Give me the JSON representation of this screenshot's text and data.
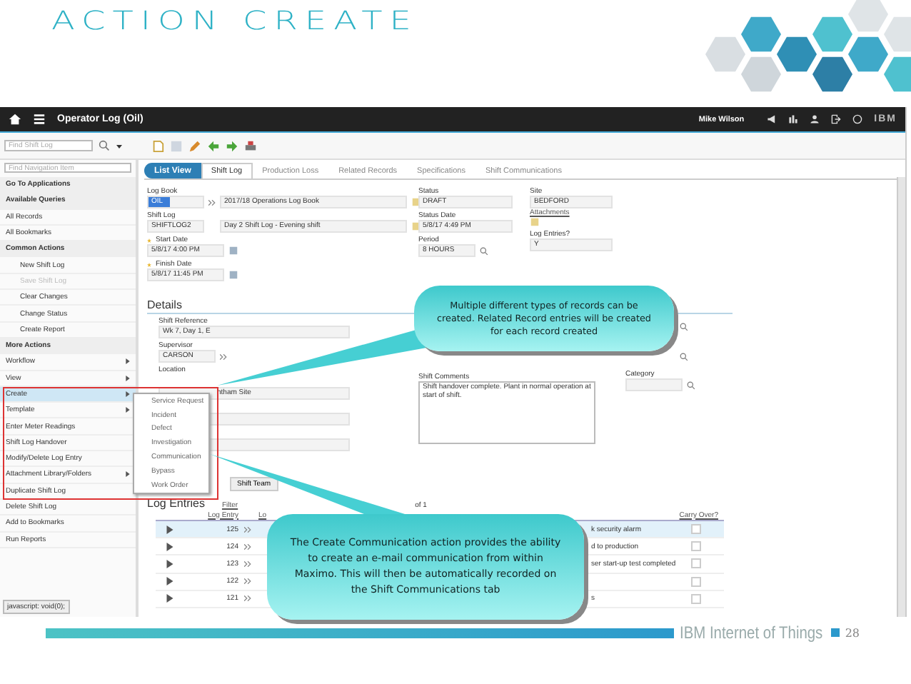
{
  "slide": {
    "title": "ACTION CREATE",
    "footer": "IBM Internet of Things",
    "page": "28"
  },
  "app": {
    "title": "Operator Log (Oil)",
    "user": "Mike Wilson",
    "brand": "IBM",
    "find_placeholder": "Find Shift Log",
    "status_bar": "javascript: void(0);"
  },
  "sidebar": {
    "search_placeholder": "Find Navigation Item",
    "items": [
      {
        "kind": "header",
        "label": "Go To Applications"
      },
      {
        "kind": "header",
        "label": "Available Queries"
      },
      {
        "kind": "link",
        "label": "All Records"
      },
      {
        "kind": "link",
        "label": "All Bookmarks"
      },
      {
        "kind": "header",
        "label": "Common Actions"
      },
      {
        "kind": "action",
        "label": "New Shift Log",
        "disabled": false
      },
      {
        "kind": "action",
        "label": "Save Shift Log",
        "disabled": true
      },
      {
        "kind": "action",
        "label": "Clear Changes",
        "disabled": false
      },
      {
        "kind": "action",
        "label": "Change Status",
        "disabled": false
      },
      {
        "kind": "action",
        "label": "Create Report",
        "disabled": false
      },
      {
        "kind": "header",
        "label": "More Actions"
      },
      {
        "kind": "menu",
        "label": "Workflow",
        "has_submenu": true,
        "selected": false
      },
      {
        "kind": "menu",
        "label": "View",
        "has_submenu": true,
        "selected": false
      },
      {
        "kind": "menu",
        "label": "Create",
        "has_submenu": true,
        "selected": true
      },
      {
        "kind": "menu",
        "label": "Template",
        "has_submenu": true,
        "selected": false
      },
      {
        "kind": "menu",
        "label": "Enter Meter Readings",
        "has_submenu": false,
        "selected": false
      },
      {
        "kind": "menu",
        "label": "Shift Log Handover",
        "has_submenu": false,
        "selected": false
      },
      {
        "kind": "menu",
        "label": "Modify/Delete Log Entry",
        "has_submenu": false,
        "selected": false
      },
      {
        "kind": "menu",
        "label": "Attachment Library/Folders",
        "has_submenu": true,
        "selected": false
      },
      {
        "kind": "menu",
        "label": "Duplicate Shift Log",
        "has_submenu": false,
        "selected": false
      },
      {
        "kind": "menu",
        "label": "Delete Shift Log",
        "has_submenu": false,
        "selected": false
      },
      {
        "kind": "menu",
        "label": "Add to Bookmarks",
        "has_submenu": false,
        "selected": false
      },
      {
        "kind": "menu",
        "label": "Run Reports",
        "has_submenu": false,
        "selected": false
      }
    ]
  },
  "popup_menu": [
    "Service Request",
    "Incident",
    "Defect",
    "Investigation",
    "Communication",
    "Bypass",
    "Work Order"
  ],
  "list_view_button": "List View",
  "tabs": [
    {
      "label": "Shift Log",
      "selected": true
    },
    {
      "label": "Production Loss",
      "selected": false
    },
    {
      "label": "Related Records",
      "selected": false
    },
    {
      "label": "Specifications",
      "selected": false
    },
    {
      "label": "Shift Communications",
      "selected": false
    }
  ],
  "record": {
    "log_book": {
      "label": "Log Book",
      "code": "OIL",
      "description": "2017/18 Operations Log Book"
    },
    "shift_log": {
      "label": "Shift Log",
      "code": "SHIFTLOG2",
      "description": "Day 2 Shift Log - Evening shift"
    },
    "start_date": {
      "label": "Start Date",
      "value": "5/8/17 4:00 PM",
      "required": true
    },
    "finish_date": {
      "label": "Finish Date",
      "value": "5/8/17 11:45 PM",
      "required": true
    },
    "status": {
      "label": "Status",
      "value": "DRAFT"
    },
    "status_date": {
      "label": "Status Date",
      "value": "5/8/17 4:49 PM"
    },
    "period": {
      "label": "Period",
      "value": "8 HOURS"
    },
    "site": {
      "label": "Site",
      "value": "BEDFORD"
    },
    "attachments": "Attachments",
    "log_entries_flag": {
      "label": "Log Entries?",
      "value": "Y"
    }
  },
  "details": {
    "title": "Details",
    "shift_reference": {
      "label": "Shift Reference",
      "value": "Wk 7, Day 1, E"
    },
    "supervisor": {
      "label": "Supervisor",
      "value": "CARSON"
    },
    "location": {
      "label": "Location",
      "value": "ntham Site"
    },
    "shift_comments": {
      "label": "Shift Comments",
      "value": "Shift handover complete. Plant in normal operation at start of shift."
    },
    "category": {
      "label": "Category"
    },
    "shift_team_button": "Shift Team"
  },
  "log_entries": {
    "title": "Log Entries",
    "filter": "Filter",
    "pagination": "of 1",
    "columns": [
      "Log Entry",
      "Lo",
      "Carry Over?"
    ],
    "rows": [
      {
        "entry": "125",
        "description": "k security alarm",
        "selected": true,
        "carry_over": false
      },
      {
        "entry": "124",
        "description": "d to production",
        "selected": false,
        "carry_over": false
      },
      {
        "entry": "123",
        "description": "ser start-up test completed",
        "selected": false,
        "carry_over": false
      },
      {
        "entry": "122",
        "description": "",
        "selected": false,
        "carry_over": false
      },
      {
        "entry": "121",
        "description": "s",
        "selected": false,
        "carry_over": false
      }
    ]
  },
  "callouts": [
    "Multiple different types of records can be created. Related Record entries will be created for each record created",
    "The Create Communication action provides the ability to create an e-mail communication from within Maximo. This will then be automatically recorded on the Shift Communications tab"
  ]
}
